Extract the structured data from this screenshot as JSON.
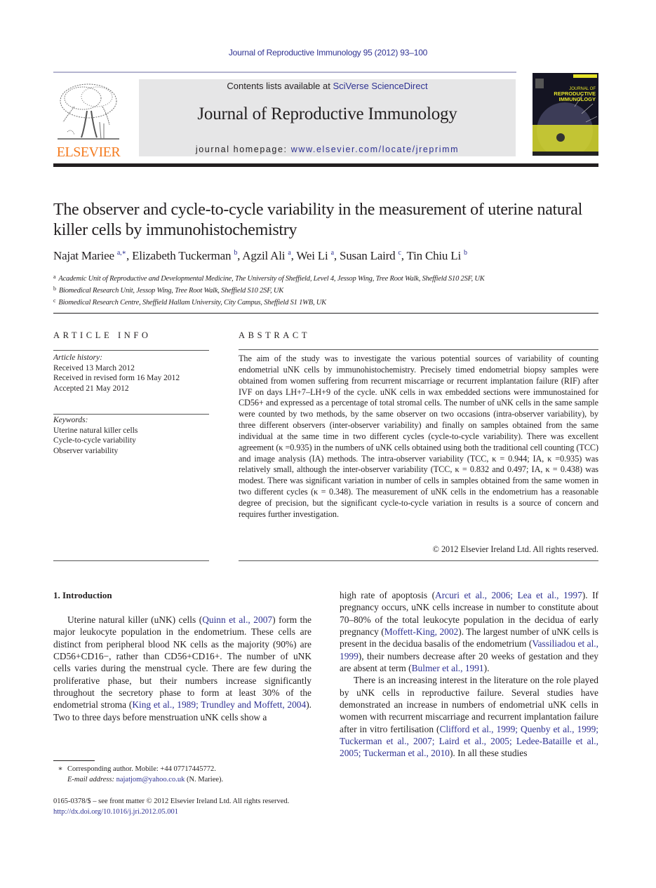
{
  "running_head": "Journal of Reproductive Immunology 95 (2012) 93–100",
  "logo": {
    "publisher_word": "ELSEVIER",
    "icon": "elsevier-tree-icon"
  },
  "banner": {
    "contents_prefix": "Contents lists available at ",
    "contents_link": "SciVerse ScienceDirect",
    "journal_title": "Journal of Reproductive Immunology",
    "homepage_prefix": "journal homepage: ",
    "homepage_link": "www.elsevier.com/locate/jreprimm"
  },
  "cover": {
    "line1": "JOURNAL OF",
    "line2": "REPRODUCTIVE",
    "line3": "IMMUNOLOGY"
  },
  "article": {
    "title": "The observer and cycle-to-cycle variability in the measurement of uterine natural killer cells by immunohistochemistry",
    "authors": [
      {
        "name": "Najat Mariee",
        "sup": "a,∗",
        "sep": ", "
      },
      {
        "name": "Elizabeth Tuckerman",
        "sup": "b",
        "sep": ", "
      },
      {
        "name": "Agzil Ali",
        "sup": "a",
        "sep": ", "
      },
      {
        "name": "Wei Li",
        "sup": "a",
        "sep": ", "
      },
      {
        "name": "Susan Laird",
        "sup": "c",
        "sep": ", "
      },
      {
        "name": "Tin Chiu Li",
        "sup": "b",
        "sep": ""
      }
    ],
    "affiliations": [
      {
        "key": "a",
        "text": "Academic Unit of Reproductive and Developmental Medicine, The University of Sheffield, Level 4, Jessop Wing, Tree Root Walk, Sheffield S10 2SF, UK"
      },
      {
        "key": "b",
        "text": "Biomedical Research Unit, Jessop Wing, Tree Root Walk, Sheffield S10 2SF, UK"
      },
      {
        "key": "c",
        "text": "Biomedical Research Centre, Sheffield Hallam University, City Campus, Sheffield S1 1WB, UK"
      }
    ]
  },
  "article_info": {
    "heading": "ARTICLE INFO",
    "history_label": "Article history:",
    "history": [
      "Received 13 March 2012",
      "Received in revised form 16 May 2012",
      "Accepted 21 May 2012"
    ],
    "keywords_label": "Keywords:",
    "keywords": [
      "Uterine natural killer cells",
      "Cycle-to-cycle variability",
      "Observer variability"
    ]
  },
  "abstract": {
    "heading": "ABSTRACT",
    "text": "The aim of the study was to investigate the various potential sources of variability of counting endometrial uNK cells by immunohistochemistry. Precisely timed endometrial biopsy samples were obtained from women suffering from recurrent miscarriage or recur­rent implantation failure (RIF) after IVF on days LH+7–LH+9 of the cycle. uNK cells in wax embedded sections were immunostained for CD56+ and expressed as a percentage of total stromal cells. The number of uNK cells in the same sample were counted by two methods, by the same observer on two occasions (intra-observer variability), by three dif­ferent observers (inter-observer variability) and finally on samples obtained from the same individual at the same time in two different cycles (cycle-to-cycle variability). There was excellent agreement (κ =0.935) in the numbers of uNK cells obtained using both the tradi­tional cell counting (TCC) and image analysis (IA) methods. The intra-observer variability (TCC, κ = 0.944; IA, κ =0.935) was relatively small, although the inter-observer variability (TCC, κ = 0.832 and 0.497; IA, κ = 0.438) was modest. There was significant variation in num­ber of cells in samples obtained from the same women in two different cycles (κ = 0.348). The measurement of uNK cells in the endometrium has a reasonable degree of precision, but the significant cycle-to-cycle variation in results is a source of concern and requires further investigation.",
    "copyright": "© 2012 Elsevier Ireland Ltd. All rights reserved."
  },
  "body": {
    "section_heading": "1.  Introduction",
    "left_column": [
      {
        "t": "Uterine natural killer (uNK) cells ("
      },
      {
        "l": "Quinn et al., 2007"
      },
      {
        "t": ") form the major leukocyte population in the endometrium. These cells are distinct from peripheral blood NK cells as the majority (90%) are CD56+CD16−, rather than CD56+CD16+. The number of uNK cells varies during the menstrual cycle. There are few during the proliferative phase, but their numbers increase significantly throughout the secretory phase to form at least 30% of the endometrial stroma ("
      },
      {
        "l": "King et al., 1989; Trundley and Moffett, 2004"
      },
      {
        "t": "). Two to three days before menstruation uNK cells show a"
      }
    ],
    "right_column_p1": [
      {
        "t": "high rate of apoptosis ("
      },
      {
        "l": "Arcuri et al., 2006; Lea et al., 1997"
      },
      {
        "t": "). If pregnancy occurs, uNK cells increase in number to constitute about 70–80% of the total leukocyte population in the decidua of early pregnancy ("
      },
      {
        "l": "Moffett-King, 2002"
      },
      {
        "t": "). The largest number of uNK cells is present in the decidua basalis of the endometrium ("
      },
      {
        "l": "Vassiliadou et al., 1999"
      },
      {
        "t": "), their numbers decrease after 20 weeks of gestation and they are absent at term ("
      },
      {
        "l": "Bulmer et al., 1991"
      },
      {
        "t": ")."
      }
    ],
    "right_column_p2": [
      {
        "t": "There is an increasing interest in the literature on the role played by uNK cells in reproductive failure. Sev­eral studies have demonstrated an increase in numbers of endometrial uNK cells in women with recurrent mis­carriage and recurrent implantation failure after in vitro fertilisation ("
      },
      {
        "l": "Clifford et al., 1999; Quenby et al., 1999; Tuckerman et al., 2007; Laird et al., 2005; Ledee-Bataille et al., 2005; Tuckerman et al., 2010"
      },
      {
        "t": "). In all these studies"
      }
    ]
  },
  "footnote": {
    "star": "∗",
    "corresponding": "Corresponding author. Mobile: +44 07717445772.",
    "email_label": "E-mail address:",
    "email": "najatjom@yahoo.co.uk",
    "email_suffix": " (N. Mariee)."
  },
  "footer": {
    "front_matter": "0165-0378/$ – see front matter © 2012 Elsevier Ireland Ltd. All rights reserved.",
    "doi": "http://dx.doi.org/10.1016/j.jri.2012.05.001"
  },
  "colors": {
    "link": "#2e3192",
    "elsevier_orange": "#f47b20",
    "banner_bg": "#e6e6e7",
    "text": "#231f20"
  }
}
